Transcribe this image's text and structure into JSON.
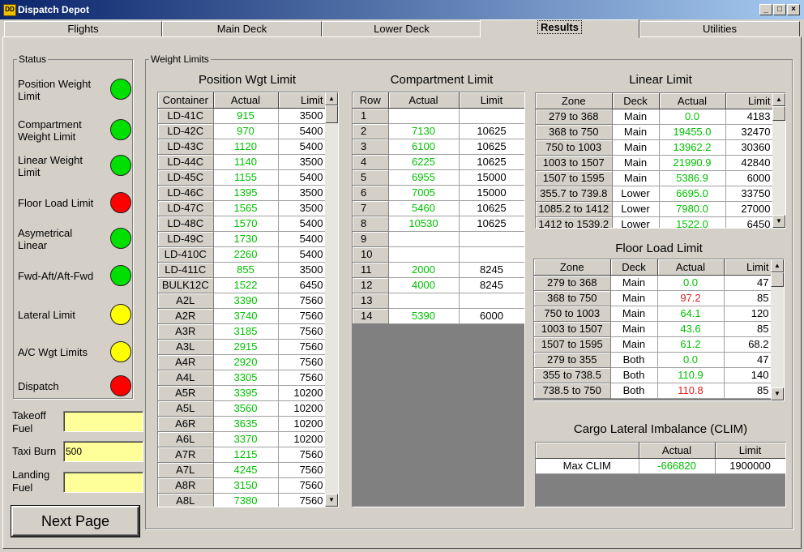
{
  "window": {
    "title": "Dispatch Depot",
    "icon_text": "DD",
    "min": "_",
    "max": "□",
    "close": "×"
  },
  "tabs": [
    "Flights",
    "Main Deck",
    "Lower Deck",
    "Results",
    "Utilities"
  ],
  "status": {
    "legend": "Status",
    "items": [
      {
        "label": "Position Weight Limit",
        "color": "#00e000"
      },
      {
        "label": "Compartment Weight Limit",
        "color": "#00e000"
      },
      {
        "label": "Linear Weight Limit",
        "color": "#00e000"
      },
      {
        "label": "Floor Load Limit",
        "color": "#ff0000"
      },
      {
        "label": "Asymetrical Linear",
        "color": "#00e000"
      },
      {
        "label": "Fwd-Aft/Aft-Fwd",
        "color": "#00e000"
      },
      {
        "label": "Lateral Limit",
        "color": "#ffff00"
      },
      {
        "label": "A/C Wgt Limits",
        "color": "#ffff00"
      },
      {
        "label": "Dispatch",
        "color": "#ff0000"
      }
    ]
  },
  "fuel": {
    "takeoff_label": "Takeoff Fuel",
    "takeoff_value": "",
    "taxi_label": "Taxi Burn",
    "taxi_value": "500",
    "landing_label": "Landing Fuel",
    "landing_value": ""
  },
  "next_button": "Next Page",
  "weight_limits": {
    "legend": "Weight Limits"
  },
  "position": {
    "title": "Position Wgt Limit",
    "headers": [
      "Container",
      "Actual",
      "Limit"
    ],
    "rows": [
      [
        "LD-41C",
        "915",
        "3500"
      ],
      [
        "LD-42C",
        "970",
        "5400"
      ],
      [
        "LD-43C",
        "1120",
        "5400"
      ],
      [
        "LD-44C",
        "1140",
        "3500"
      ],
      [
        "LD-45C",
        "1155",
        "5400"
      ],
      [
        "LD-46C",
        "1395",
        "3500"
      ],
      [
        "LD-47C",
        "1565",
        "3500"
      ],
      [
        "LD-48C",
        "1570",
        "5400"
      ],
      [
        "LD-49C",
        "1730",
        "5400"
      ],
      [
        "LD-410C",
        "2260",
        "5400"
      ],
      [
        "LD-411C",
        "855",
        "3500"
      ],
      [
        "BULK12C",
        "1522",
        "6450"
      ],
      [
        "A2L",
        "3390",
        "7560"
      ],
      [
        "A2R",
        "3740",
        "7560"
      ],
      [
        "A3R",
        "3185",
        "7560"
      ],
      [
        "A3L",
        "2915",
        "7560"
      ],
      [
        "A4R",
        "2920",
        "7560"
      ],
      [
        "A4L",
        "3305",
        "7560"
      ],
      [
        "A5R",
        "3395",
        "10200"
      ],
      [
        "A5L",
        "3560",
        "10200"
      ],
      [
        "A6R",
        "3635",
        "10200"
      ],
      [
        "A6L",
        "3370",
        "10200"
      ],
      [
        "A7R",
        "1215",
        "7560"
      ],
      [
        "A7L",
        "4245",
        "7560"
      ],
      [
        "A8R",
        "3150",
        "7560"
      ],
      [
        "A8L",
        "7380",
        "7560"
      ]
    ]
  },
  "compartment": {
    "title": "Compartment Limit",
    "headers": [
      "Row",
      "Actual",
      "Limit"
    ],
    "rows": [
      [
        "1",
        "",
        ""
      ],
      [
        "2",
        "7130",
        "10625"
      ],
      [
        "3",
        "6100",
        "10625"
      ],
      [
        "4",
        "6225",
        "10625"
      ],
      [
        "5",
        "6955",
        "15000"
      ],
      [
        "6",
        "7005",
        "15000"
      ],
      [
        "7",
        "5460",
        "10625"
      ],
      [
        "8",
        "10530",
        "10625"
      ],
      [
        "9",
        "",
        ""
      ],
      [
        "10",
        "",
        ""
      ],
      [
        "11",
        "2000",
        "8245"
      ],
      [
        "12",
        "4000",
        "8245"
      ],
      [
        "13",
        "",
        ""
      ],
      [
        "14",
        "5390",
        "6000"
      ]
    ]
  },
  "linear": {
    "title": "Linear Limit",
    "headers": [
      "Zone",
      "Deck",
      "Actual",
      "Limit"
    ],
    "rows": [
      [
        "279  to  368",
        "Main",
        "0.0",
        "4183",
        "g"
      ],
      [
        "368  to  750",
        "Main",
        "19455.0",
        "32470",
        "g"
      ],
      [
        "750  to  1003",
        "Main",
        "13962.2",
        "30360",
        "g"
      ],
      [
        "1003  to  1507",
        "Main",
        "21990.9",
        "42840",
        "g"
      ],
      [
        "1507  to  1595",
        "Main",
        "5386.9",
        "6000",
        "g"
      ],
      [
        "355.7  to  739.8",
        "Lower",
        "6695.0",
        "33750",
        "g"
      ],
      [
        "1085.2  to  1412",
        "Lower",
        "7980.0",
        "27000",
        "g"
      ],
      [
        "1412  to  1539.2",
        "Lower",
        "1522.0",
        "6450",
        "g"
      ]
    ]
  },
  "floor": {
    "title": "Floor Load Limit",
    "headers": [
      "Zone",
      "Deck",
      "Actual",
      "Limit"
    ],
    "rows": [
      [
        "279  to  368",
        "Main",
        "0.0",
        "47",
        "g"
      ],
      [
        "368  to  750",
        "Main",
        "97.2",
        "85",
        "r"
      ],
      [
        "750  to  1003",
        "Main",
        "64.1",
        "120",
        "g"
      ],
      [
        "1003  to  1507",
        "Main",
        "43.6",
        "85",
        "g"
      ],
      [
        "1507  to  1595",
        "Main",
        "61.2",
        "68.2",
        "g"
      ],
      [
        "279  to  355",
        "Both",
        "0.0",
        "47",
        "g"
      ],
      [
        "355  to  738.5",
        "Both",
        "110.9",
        "140",
        "g"
      ],
      [
        "738.5  to  750",
        "Both",
        "110.8",
        "85",
        "r"
      ]
    ]
  },
  "clim": {
    "title": "Cargo Lateral Imbalance (CLIM)",
    "headers": [
      "",
      "Actual",
      "Limit"
    ],
    "row": [
      "Max CLIM",
      "-666820",
      "1900000"
    ]
  }
}
